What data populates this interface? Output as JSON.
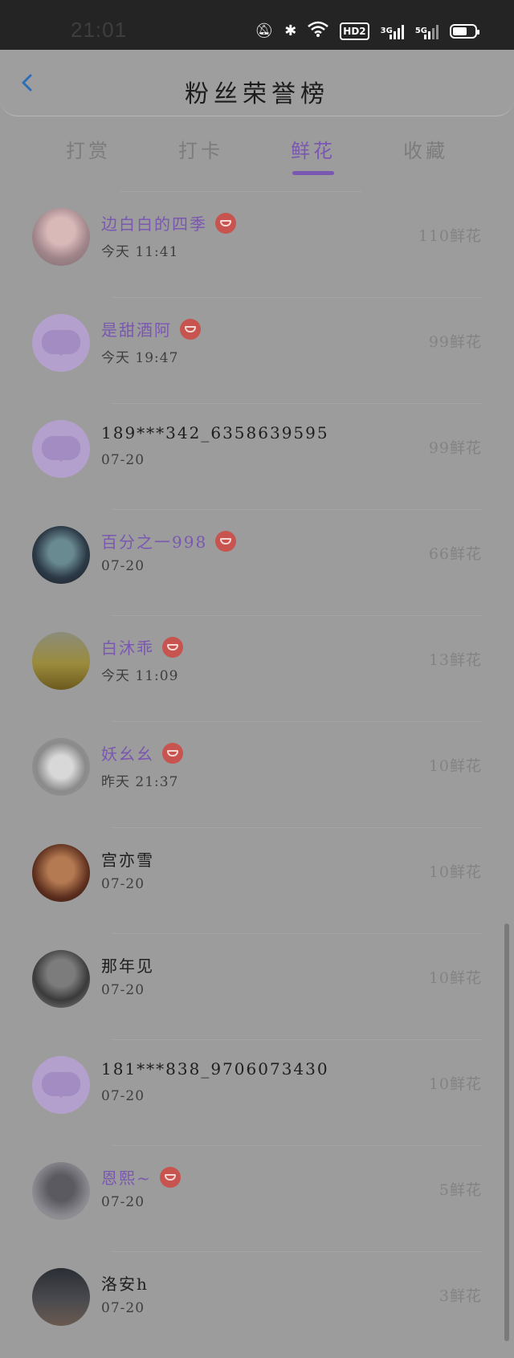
{
  "status_bar": {
    "time": "21:01",
    "network_hd": "HD2",
    "signal1": "3G",
    "signal2": "5G"
  },
  "header": {
    "title": "粉丝荣誉榜"
  },
  "tabs": [
    {
      "label": "打赏",
      "active": false
    },
    {
      "label": "打卡",
      "active": false
    },
    {
      "label": "鲜花",
      "active": true
    },
    {
      "label": "收藏",
      "active": false
    }
  ],
  "fans": [
    {
      "name": "边白白的四季",
      "time": "今天 11:41",
      "count": "110鲜花",
      "vip": true,
      "avatar": "photo-avatar"
    },
    {
      "name": "是甜酒阿",
      "time": "今天 19:47",
      "count": "99鲜花",
      "vip": true,
      "avatar": "default-avatar"
    },
    {
      "name": "189***342_6358639595",
      "time": "07-20",
      "count": "99鲜花",
      "vip": false,
      "avatar": "default-avatar"
    },
    {
      "name": "百分之一998",
      "time": "07-20",
      "count": "66鲜花",
      "vip": true,
      "avatar": "photo-avatar"
    },
    {
      "name": "白沐乖",
      "time": "今天 11:09",
      "count": "13鲜花",
      "vip": true,
      "avatar": "photo-avatar"
    },
    {
      "name": "妖幺幺",
      "time": "昨天 21:37",
      "count": "10鲜花",
      "vip": true,
      "avatar": "photo-avatar"
    },
    {
      "name": "宫亦雪",
      "time": "07-20",
      "count": "10鲜花",
      "vip": false,
      "avatar": "photo-avatar"
    },
    {
      "name": "那年见",
      "time": "07-20",
      "count": "10鲜花",
      "vip": false,
      "avatar": "photo-avatar"
    },
    {
      "name": "181***838_9706073430",
      "time": "07-20",
      "count": "10鲜花",
      "vip": false,
      "avatar": "default-avatar"
    },
    {
      "name": "恩熙~",
      "time": "07-20",
      "count": "5鲜花",
      "vip": true,
      "avatar": "photo-avatar"
    },
    {
      "name": "洛安h",
      "time": "07-20",
      "count": "3鲜花",
      "vip": false,
      "avatar": "photo-avatar"
    }
  ],
  "colors": {
    "accent": "#7a57b0",
    "vip_badge": "#c7544e",
    "overlay_bg": "#9c9c9c"
  }
}
